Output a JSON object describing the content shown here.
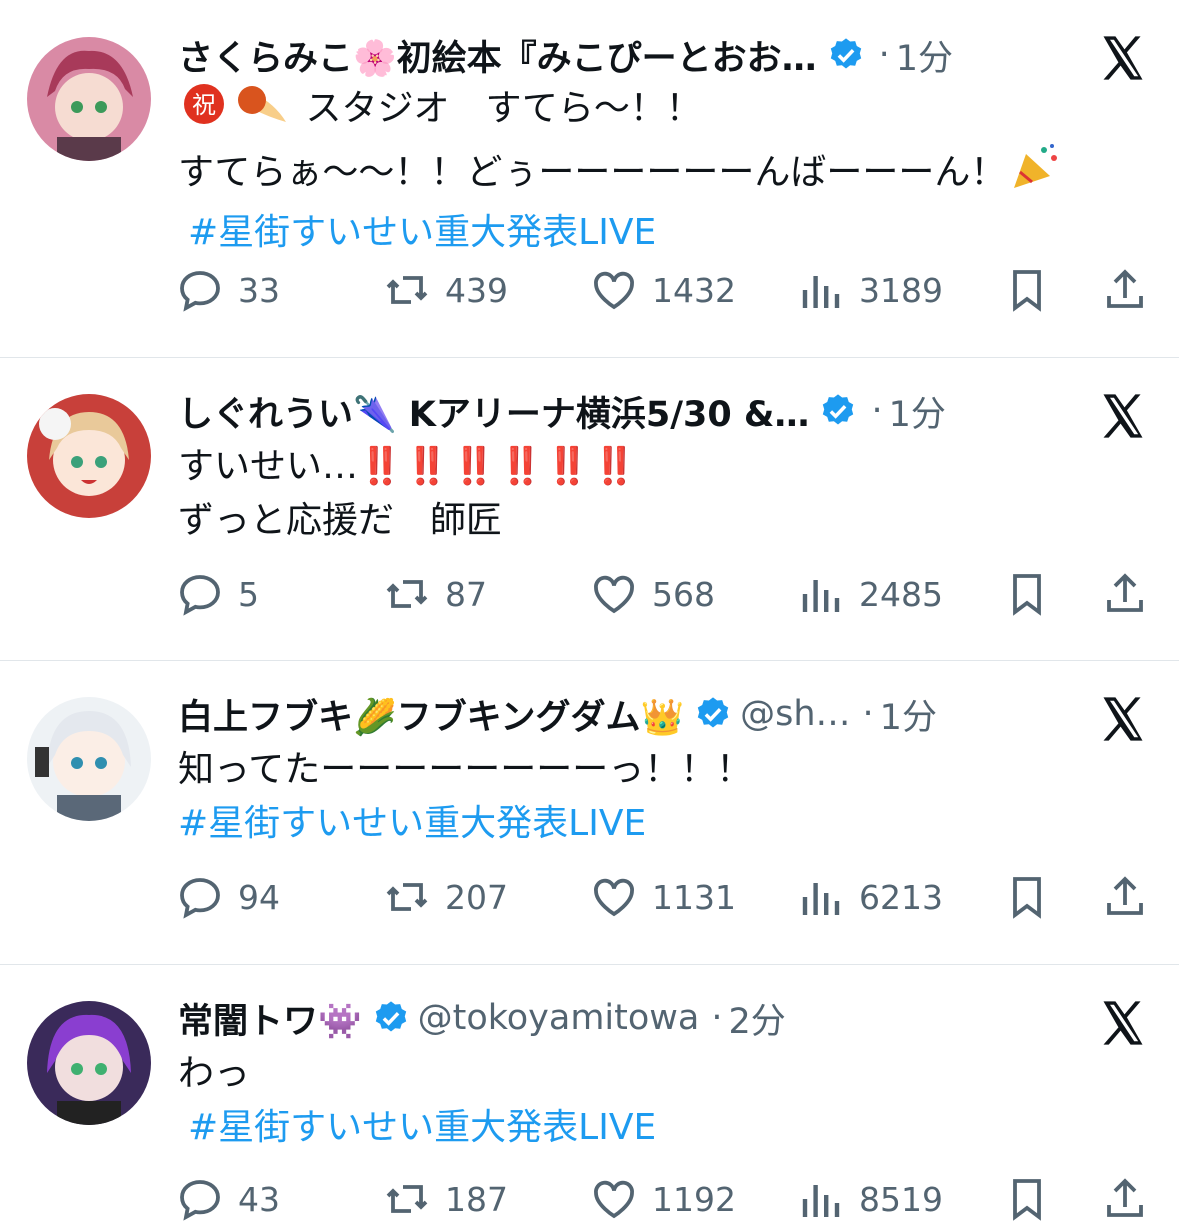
{
  "colors": {
    "link": "#1d9bf0",
    "muted": "#536471",
    "verified": "#1d9bf0",
    "divider": "#e1e6ea"
  },
  "tweets": [
    {
      "name": "さくらみこ🌸初絵本『みこぴーとおお…",
      "handle": "",
      "dot": "·",
      "time": "1分",
      "lines": [
        "スタジオ　すてら〜！！",
        "すてらぁ〜〜！！どぅーーーーーーんばーーーん！"
      ],
      "hashtag": "#星街すいせい重大発表LIVE",
      "replies": "33",
      "reposts": "439",
      "likes": "1432",
      "views": "3189"
    },
    {
      "name": "しぐれうい🌂 Kアリーナ横浜5/30 &…",
      "handle": "",
      "dot": "·",
      "time": "1分",
      "lines": [
        "すいせい…",
        "ずっと応援だ　師匠"
      ],
      "bangs": "‼️‼️‼️‼️‼️‼️",
      "hashtag": "",
      "replies": "5",
      "reposts": "87",
      "likes": "568",
      "views": "2485"
    },
    {
      "name": "白上フブキ🌽フブキングダム👑",
      "handle": "@sh…",
      "dot": "·",
      "time": "1分",
      "lines": [
        "知ってたーーーーーーーーっ！！！"
      ],
      "hashtag": "#星街すいせい重大発表LIVE",
      "replies": "94",
      "reposts": "207",
      "likes": "1131",
      "views": "6213"
    },
    {
      "name": "常闇トワ👾",
      "handle": "@tokoyamitowa",
      "dot": "·",
      "time": "2分",
      "lines": [
        "わっ"
      ],
      "hashtag": "#星街すいせい重大発表LIVE",
      "replies": "43",
      "reposts": "187",
      "likes": "1192",
      "views": "8519"
    }
  ],
  "icons": {
    "reply": "reply-icon",
    "repost": "repost-icon",
    "like": "heart-icon",
    "views": "views-icon",
    "bookmark": "bookmark-icon",
    "share": "share-icon",
    "brand": "x-logo-icon",
    "badge": "verified-badge-icon"
  }
}
